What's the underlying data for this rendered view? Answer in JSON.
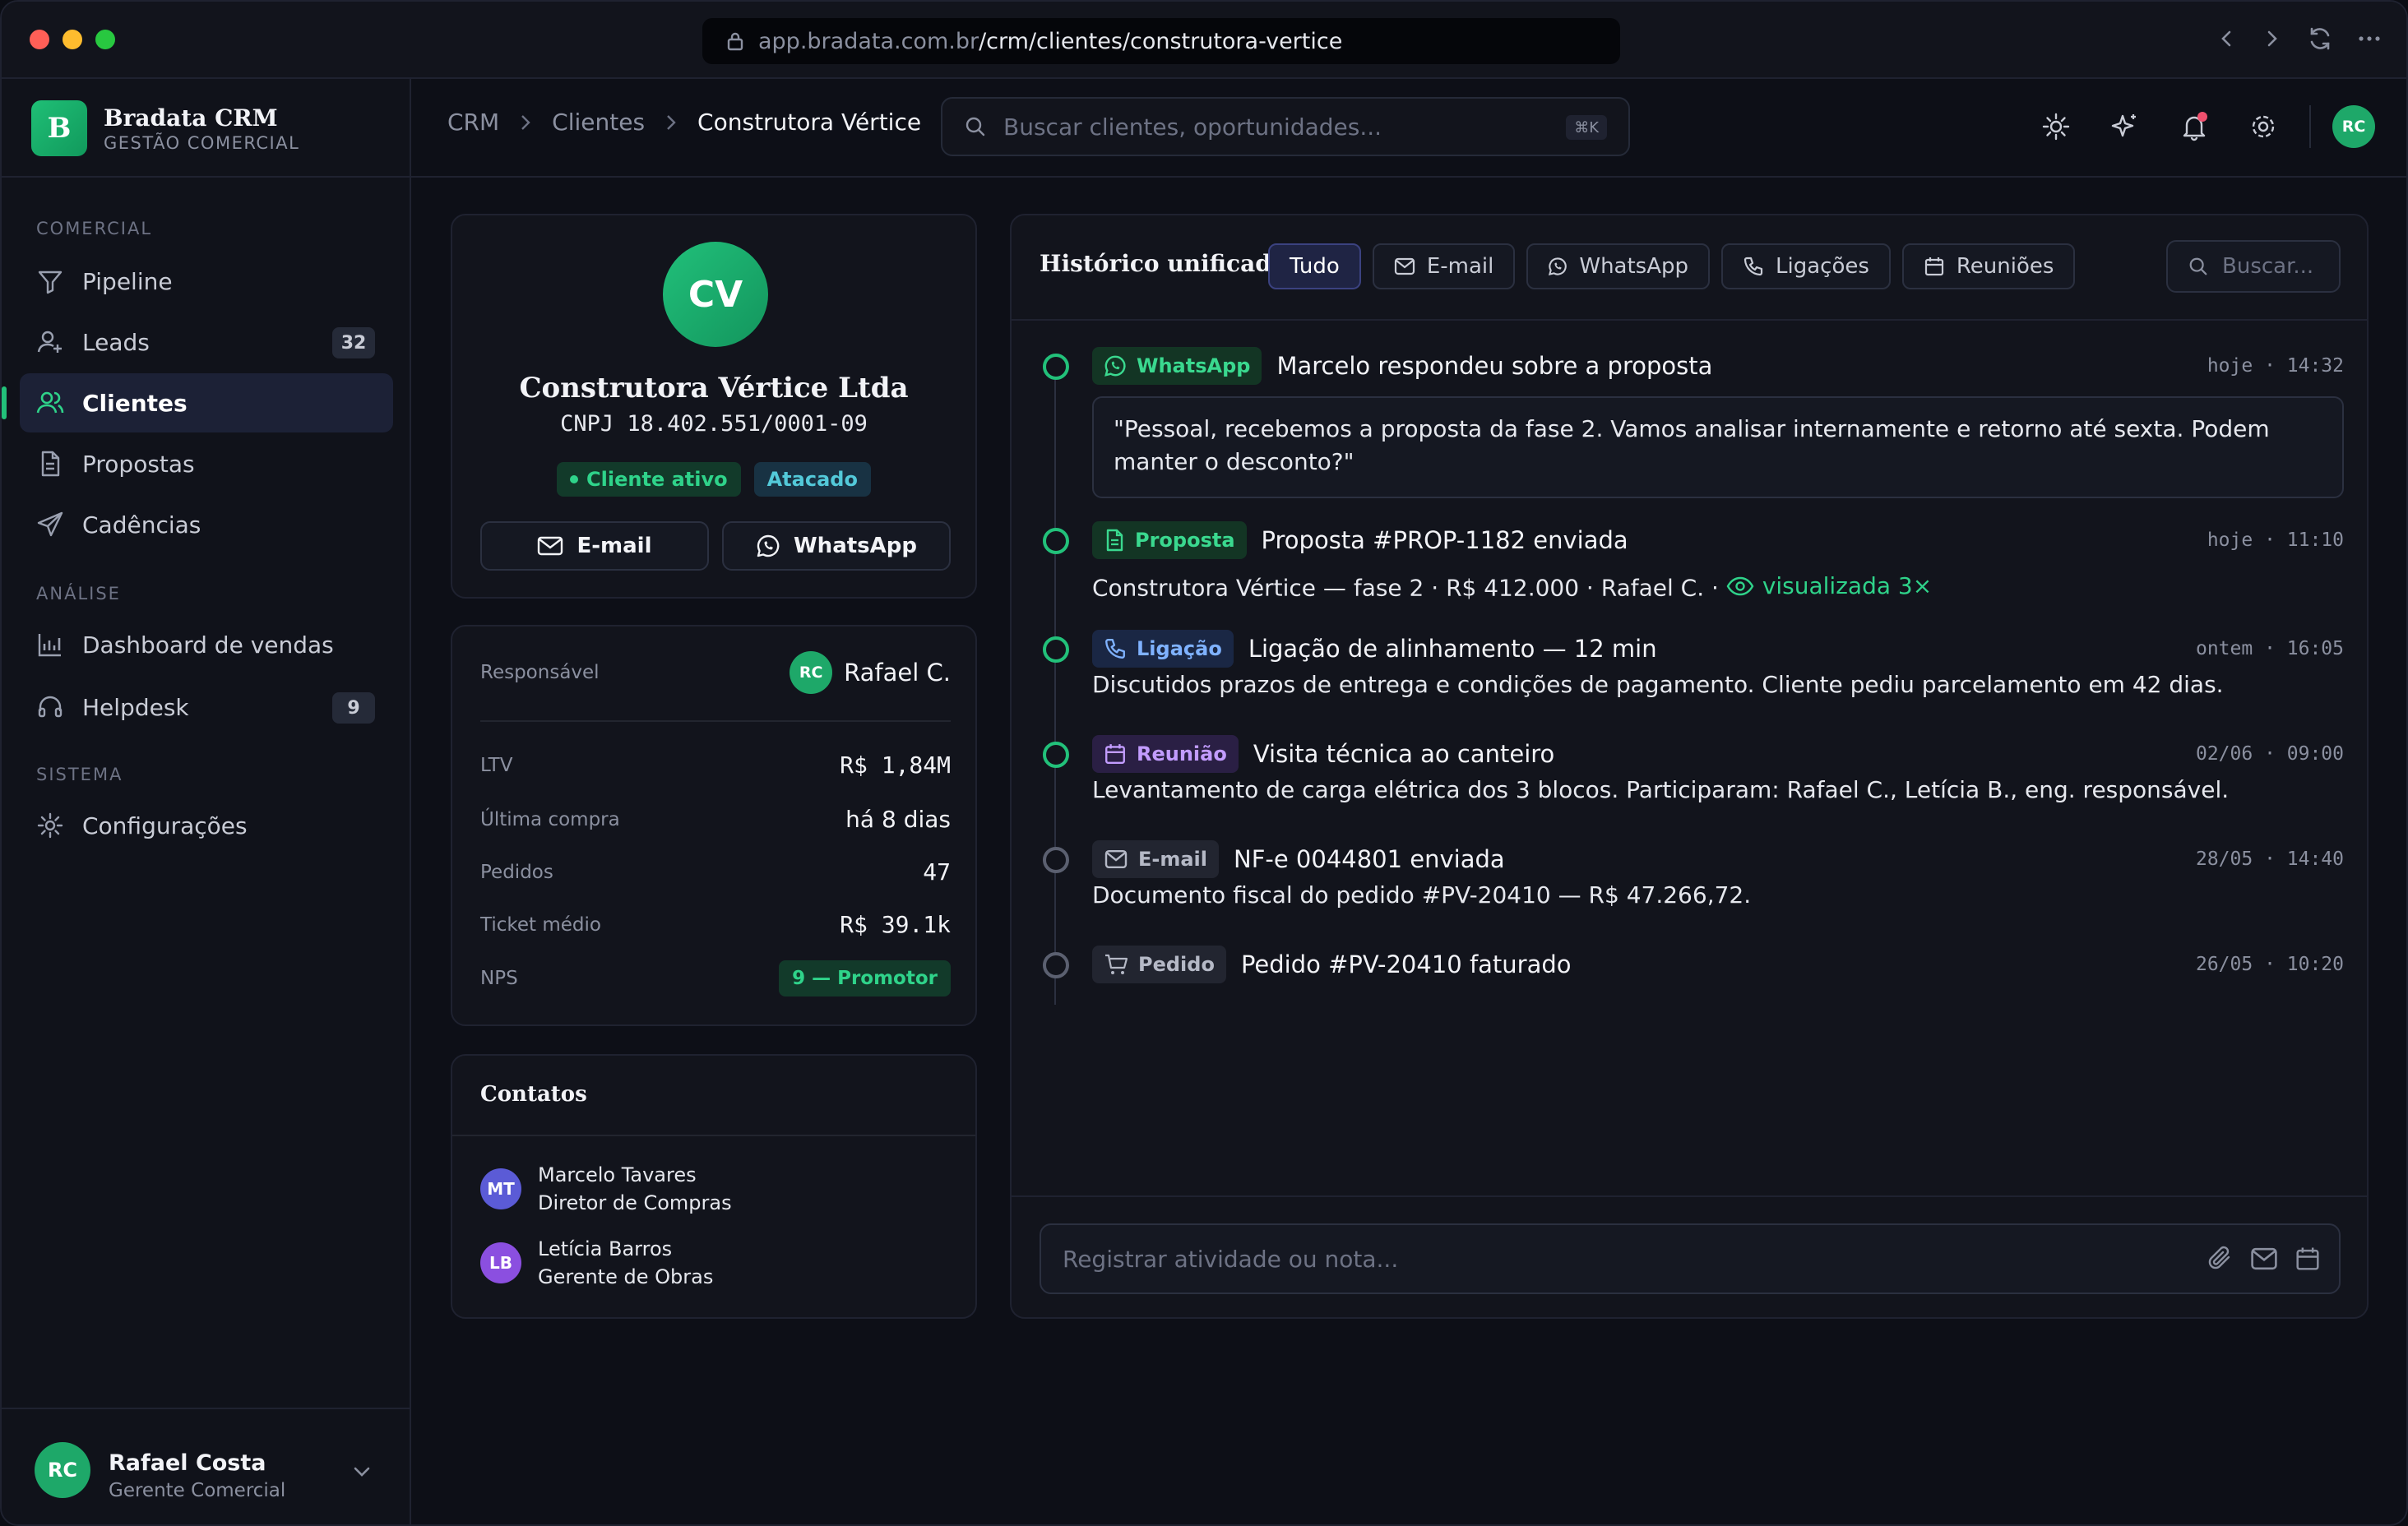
{
  "browser": {
    "url_host": "app.bradata.com.br",
    "url_path": "/crm/clientes/construtora-vertice"
  },
  "brand": {
    "logo_letter": "B",
    "name": "Bradata CRM",
    "subtitle": "GESTÃO COMERCIAL"
  },
  "sidebar": {
    "sections": [
      "COMERCIAL",
      "ANÁLISE",
      "SISTEMA"
    ],
    "items": [
      {
        "label": "Pipeline",
        "icon": "filter-icon"
      },
      {
        "label": "Leads",
        "icon": "user-plus-icon",
        "badge": "32"
      },
      {
        "label": "Clientes",
        "icon": "users-icon",
        "active": true
      },
      {
        "label": "Propostas",
        "icon": "document-icon"
      },
      {
        "label": "Cadências",
        "icon": "send-icon"
      },
      {
        "label": "Dashboard de vendas",
        "icon": "bar-chart-icon"
      },
      {
        "label": "Helpdesk",
        "icon": "headset-icon",
        "badge": "9"
      },
      {
        "label": "Configurações",
        "icon": "gear-icon"
      }
    ],
    "user": {
      "initials": "RC",
      "name": "Rafael Costa",
      "role": "Gerente Comercial"
    }
  },
  "header": {
    "breadcrumbs": [
      "CRM",
      "Clientes",
      "Construtora Vértice"
    ],
    "search_placeholder": "Buscar clientes, oportunidades...",
    "search_shortcut": "⌘K",
    "avatar_initials": "RC"
  },
  "profile": {
    "initials": "CV",
    "company": "Construtora Vértice Ltda",
    "cnpj": "CNPJ 18.402.551/0001-09",
    "tags": [
      "Cliente ativo",
      "Atacado"
    ],
    "email_btn": "E-mail",
    "whatsapp_btn": "WhatsApp"
  },
  "stats": {
    "owner_label": "Responsável",
    "owner_initials": "RC",
    "owner_name": "Rafael C.",
    "rows": [
      {
        "label": "LTV",
        "value": "R$ 1,84M"
      },
      {
        "label": "Última compra",
        "value": "há 8 dias"
      },
      {
        "label": "Pedidos",
        "value": "47"
      },
      {
        "label": "Ticket médio",
        "value": "R$ 39.1k"
      },
      {
        "label": "NPS",
        "value": "9 — Promotor"
      }
    ]
  },
  "contacts": {
    "title": "Contatos",
    "items": [
      {
        "initials": "MT",
        "name": "Marcelo Tavares",
        "role": "Diretor de Compras",
        "color": "#5b5bd6"
      },
      {
        "initials": "LB",
        "name": "Letícia Barros",
        "role": "Gerente de Obras",
        "color": "#8b4fe0"
      }
    ]
  },
  "timeline": {
    "title": "Histórico unificado",
    "filters": [
      "Tudo",
      "E-mail",
      "WhatsApp",
      "Ligações",
      "Reuniões"
    ],
    "search_placeholder": "Buscar...",
    "events": [
      {
        "type": "WhatsApp",
        "title": "Marcelo respondeu sobre a proposta",
        "time": "hoje · 14:32",
        "body": "\"Pessoal, recebemos a proposta da fase 2. Vamos analisar internamente e retorno até sexta. Podem manter o desconto?\""
      },
      {
        "type": "Proposta",
        "title": "Proposta #PROP-1182 enviada",
        "time": "hoje · 11:10",
        "body": "Construtora Vértice — fase 2 · R$ 412.000 · Rafael C. ·",
        "viewed": "visualizada 3×"
      },
      {
        "type": "Ligação",
        "title": "Ligação de alinhamento — 12 min",
        "time": "ontem · 16:05",
        "body": "Discutidos prazos de entrega e condições de pagamento. Cliente pediu parcelamento em 42 dias."
      },
      {
        "type": "Reunião",
        "title": "Visita técnica ao canteiro",
        "time": "02/06 · 09:00",
        "body": "Levantamento de carga elétrica dos 3 blocos. Participaram: Rafael C., Letícia B., eng. responsável."
      },
      {
        "type": "E-mail",
        "title": "NF-e 0044801 enviada",
        "time": "28/05 · 14:40",
        "body": "Documento fiscal do pedido #PV-20410 — R$ 47.266,72."
      },
      {
        "type": "Pedido",
        "title": "Pedido #PV-20410 faturado",
        "time": "26/05 · 10:20"
      }
    ],
    "composer_placeholder": "Registrar atividade ou nota..."
  },
  "colors": {
    "accent": "#22c17a",
    "background": "#0d0f17",
    "card": "#12141c"
  }
}
